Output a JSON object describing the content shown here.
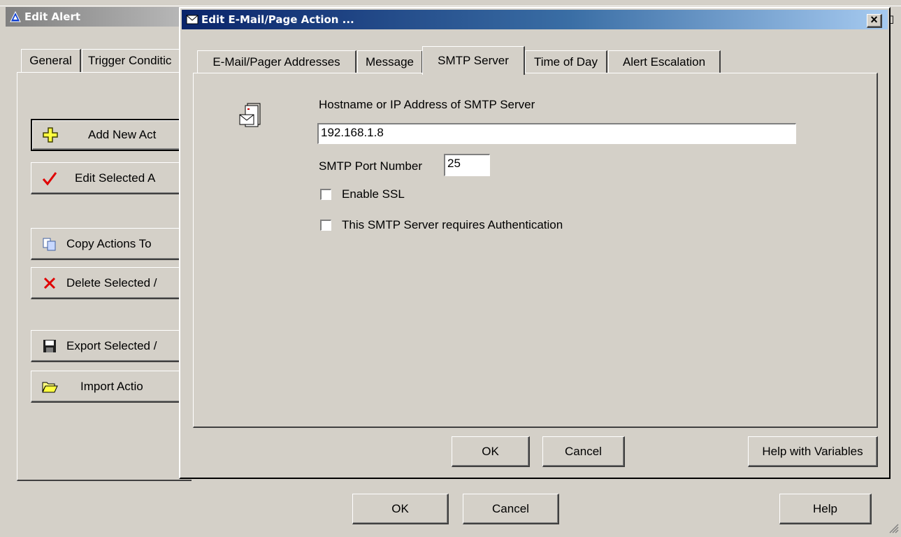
{
  "outer_window": {
    "title": "Edit Alert",
    "tabs": [
      {
        "label": "General"
      },
      {
        "label": "Trigger Conditic"
      }
    ],
    "action_buttons": [
      {
        "label": "Add New Act",
        "icon": "add-icon"
      },
      {
        "label": "Edit Selected A",
        "icon": "checkmark-icon"
      },
      {
        "label": "Copy Actions To",
        "icon": "copy-icon"
      },
      {
        "label": "Delete Selected /",
        "icon": "delete-icon"
      },
      {
        "label": "Export Selected /",
        "icon": "save-icon"
      },
      {
        "label": "Import Actio",
        "icon": "folder-open-icon"
      }
    ],
    "ok_label": "OK",
    "cancel_label": "Cancel",
    "help_label": "Help"
  },
  "dialog": {
    "title": "Edit E-Mail/Page Action ...",
    "close_label": "×",
    "tabs": [
      {
        "label": "E-Mail/Pager Addresses"
      },
      {
        "label": "Message"
      },
      {
        "label": "SMTP Server",
        "active": true
      },
      {
        "label": "Time of Day"
      },
      {
        "label": "Alert Escalation"
      }
    ],
    "smtp": {
      "hostname_label": "Hostname or IP Address of SMTP Server",
      "hostname_value": "192.168.1.8",
      "port_label": "SMTP Port Number",
      "port_value": "25",
      "ssl_label": "Enable SSL",
      "ssl_checked": false,
      "auth_label": "This SMTP Server requires Authentication",
      "auth_checked": false
    },
    "ok_label": "OK",
    "cancel_label": "Cancel",
    "help_variables_label": "Help with Variables"
  },
  "colors": {
    "titlebar_active_start": "#0a246a",
    "titlebar_active_end": "#a6caf0",
    "titlebar_inactive_start": "#808080",
    "titlebar_inactive_end": "#c0c0c0",
    "face": "#d4d0c8"
  }
}
